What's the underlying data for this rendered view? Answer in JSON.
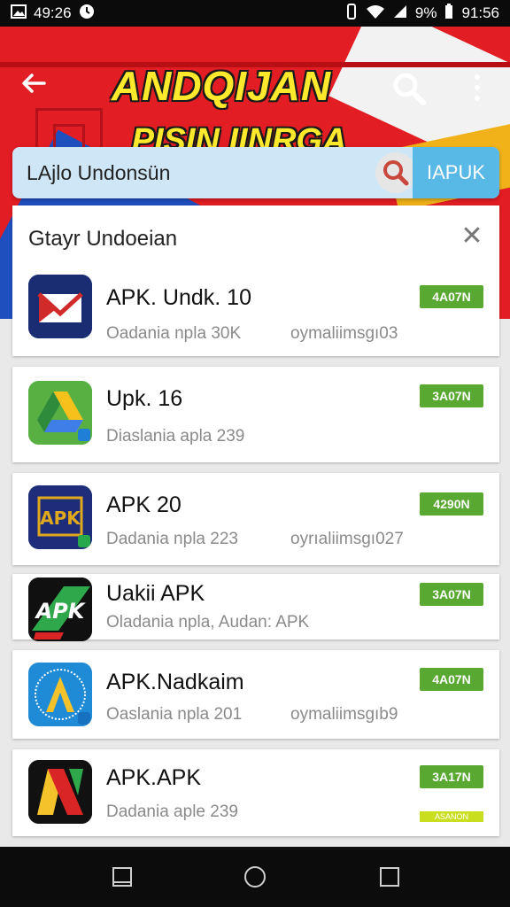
{
  "status_bar": {
    "left_time": "49:26",
    "battery_text": "9%",
    "clock": "91:56",
    "icons": [
      "gallery-icon",
      "clock-face-icon",
      "vibrate-icon",
      "wifi-icon",
      "signal-icon"
    ]
  },
  "header": {
    "title_line1": "ANDQIJAN",
    "title_line2": "PISIN IINRGA",
    "back_icon": "arrow-left-icon",
    "search_icon": "search-icon",
    "menu_icon": "more-vert-icon",
    "colors": {
      "red": "#e21d23",
      "yellow": "#ffe92c",
      "blue": "#1f4fbf"
    }
  },
  "search": {
    "query": "LAjlo Undonsün",
    "button_label": "IAPUK",
    "button_color": "#58b8e6"
  },
  "results_panel": {
    "title": "Gtayr Undoeian",
    "close_icon": "close-icon"
  },
  "apps": [
    {
      "name": "APK. Undk. 10",
      "sub": "Oadania npla  30K",
      "sub2": "oymaliimsgı03",
      "badge": "4A07N",
      "icon": "mail-icon"
    },
    {
      "name": "Upk. 16",
      "sub": "Diaslania apla  239",
      "sub2": "",
      "badge": "3A07N",
      "icon": "drive-icon"
    },
    {
      "name": "APK 20",
      "sub": "Dadania npla  223",
      "sub2": "oyrıaliimsgı027",
      "badge": "4290N",
      "icon": "apk-badge-icon"
    },
    {
      "name": "Uakii APK",
      "sub": "Oladania npla, Audan:   APK",
      "sub2": "",
      "badge": "3A07N",
      "icon": "apk-logo-icon"
    },
    {
      "name": "APK.Nadkaim",
      "sub": "Oaslania npla  201",
      "sub2": "oymaliimsgıb9",
      "badge": "4A07N",
      "icon": "a-letter-icon"
    },
    {
      "name": "APK.APK",
      "sub": "Dadania aple  239",
      "sub2": "",
      "badge": "3A17N",
      "badge2": "ASANON",
      "icon": "n-letter-icon"
    }
  ],
  "nav_bar": {
    "icons": [
      "recent-apps-icon",
      "home-icon",
      "overview-icon"
    ]
  }
}
